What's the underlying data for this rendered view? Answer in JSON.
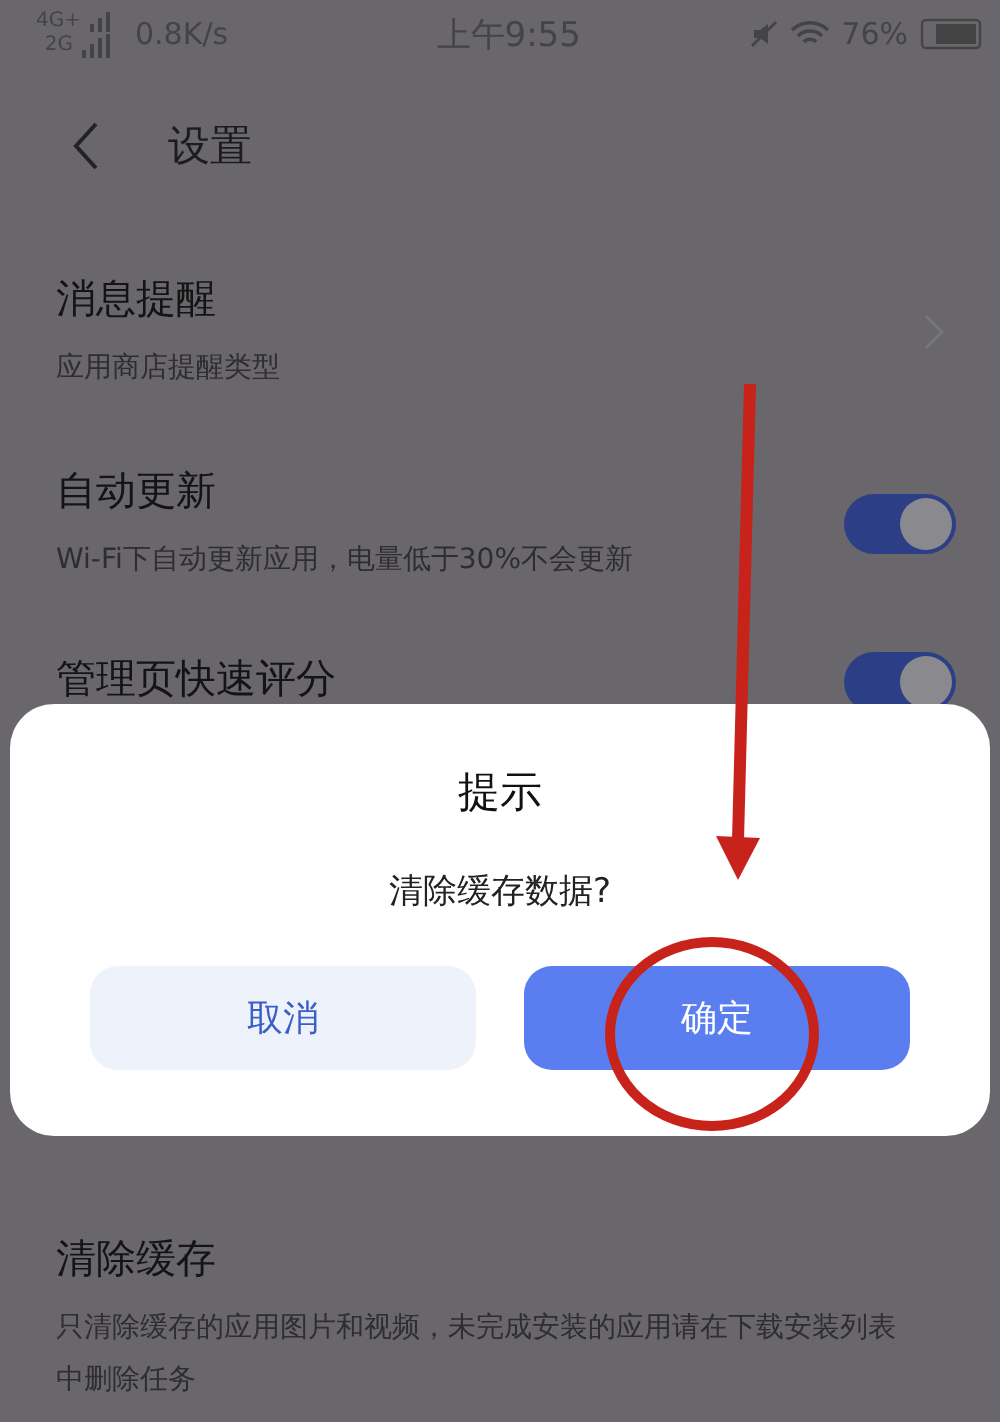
{
  "status_bar": {
    "network_top": "4G+",
    "network_bottom": "2G",
    "speed": "0.8K/s",
    "time": "上午9:55",
    "battery": "76%"
  },
  "header": {
    "title": "设置"
  },
  "settings": [
    {
      "kind": "link",
      "title": "消息提醒",
      "subtitle": "应用商店提醒类型"
    },
    {
      "kind": "toggle",
      "title": "自动更新",
      "subtitle": "Wi-Fi下自动更新应用，电量低于30%不会更新",
      "on": true
    },
    {
      "kind": "toggle",
      "title": "管理页快速评分",
      "on": true
    },
    {
      "kind": "plain",
      "title": "清除缓存",
      "subtitle": "只清除缓存的应用图片和视频，未完成安装的应用请在下载安装列表中删除任务"
    }
  ],
  "dialog": {
    "title": "提示",
    "message": "清除缓存数据?",
    "buttons": [
      {
        "label": "取消",
        "kind": "secondary"
      },
      {
        "label": "确定",
        "kind": "primary"
      }
    ]
  }
}
